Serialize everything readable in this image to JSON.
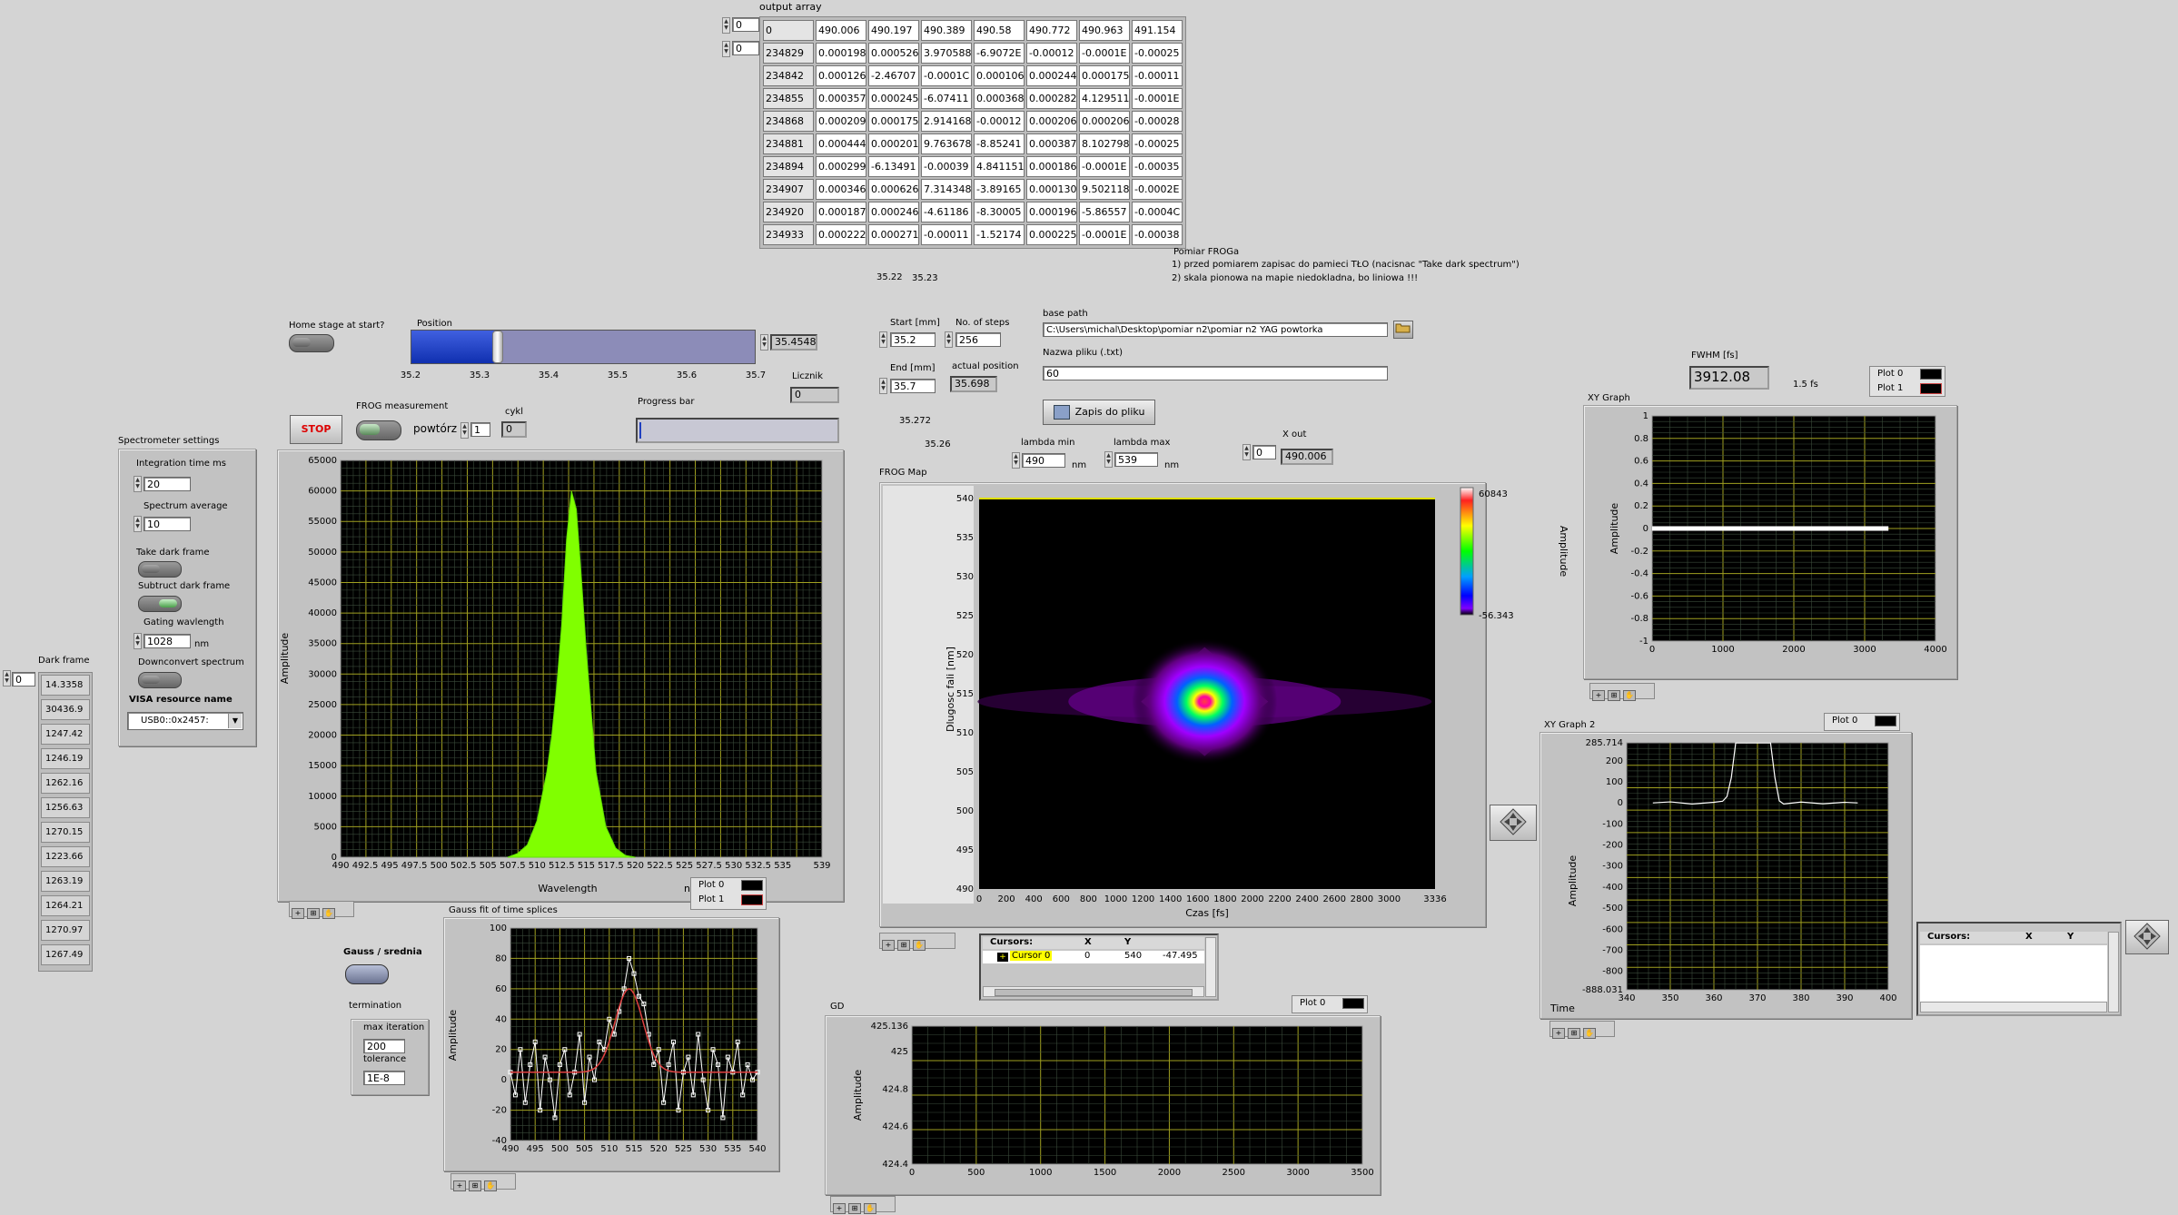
{
  "output_array": {
    "label": "output array",
    "index0": "0",
    "index1": "0",
    "rows": [
      [
        "0",
        "490.006",
        "490.197",
        "490.389",
        "490.58",
        "490.772",
        "490.963",
        "491.154"
      ],
      [
        "234829",
        "0.000198",
        "0.000526",
        "3.970588",
        "-6.9072E",
        "-0.00012",
        "-0.0001E",
        "-0.00025"
      ],
      [
        "234842",
        "0.000126",
        "-2.46707",
        "-0.0001C",
        "0.000106",
        "0.000244",
        "0.000175",
        "-0.00011"
      ],
      [
        "234855",
        "0.000357",
        "0.000245",
        "-6.07411",
        "0.000368",
        "0.000282",
        "4.129511",
        "-0.0001E"
      ],
      [
        "234868",
        "0.000209",
        "0.000175",
        "2.914168",
        "-0.00012",
        "0.000206",
        "0.000206",
        "-0.00028"
      ],
      [
        "234881",
        "0.000444",
        "0.000201",
        "9.763678",
        "-8.85241",
        "0.000387",
        "8.102798",
        "-0.00025"
      ],
      [
        "234894",
        "0.000299",
        "-6.13491",
        "-0.00039",
        "4.841151",
        "0.000186",
        "-0.0001E",
        "-0.00035"
      ],
      [
        "234907",
        "0.000346",
        "0.000626",
        "7.314348",
        "-3.89165",
        "0.000130",
        "9.502118",
        "-0.0002E"
      ],
      [
        "234920",
        "0.000187",
        "0.000246",
        "-4.61186",
        "-8.30005",
        "0.000196",
        "-5.86557",
        "-0.0004C"
      ],
      [
        "234933",
        "0.000222",
        "0.000271",
        "-0.00011",
        "-1.52174",
        "0.000225",
        "-0.0001E",
        "-0.00038"
      ]
    ]
  },
  "notes": {
    "title": "Pomiar FROGa",
    "line1": "1) przed pomiarem zapisac do pamieci TŁO (nacisnac \"Take dark spectrum\")",
    "line2": "2) skala pionowa na mapie niedokladna, bo liniowa !!!"
  },
  "floating": {
    "v1": "35.22",
    "v2": "35.23",
    "v3": "35.272",
    "v4": "35.26"
  },
  "home_stage": {
    "label": "Home stage at start?"
  },
  "position": {
    "label": "Position",
    "value": "35.4548",
    "ticks": [
      "35.2",
      "35.3",
      "35.4",
      "35.5",
      "35.6",
      "35.7"
    ],
    "fraction": 0.25
  },
  "licznik": {
    "label": "Licznik",
    "value": "0"
  },
  "progress": {
    "label": "Progress bar",
    "fraction": 0
  },
  "stop": {
    "label": "STOP"
  },
  "frog_measurement": {
    "label": "FROG measurement",
    "repeat_label": "powtórz",
    "repeat_value": "1",
    "cycle_label": "cykl",
    "cycle_value": "0"
  },
  "scan": {
    "start_label": "Start [mm]",
    "start_value": "35.2",
    "steps_label": "No. of steps",
    "steps_value": "256",
    "end_label": "End [mm]",
    "end_value": "35.7",
    "actual_label": "actual position",
    "actual_value": "35.698"
  },
  "file": {
    "base_path_label": "base path",
    "base_path_value": "C:\\Users\\michal\\Desktop\\pomiar n2\\pomiar n2 YAG powtorka",
    "name_label": "Nazwa pliku (.txt)",
    "name_value": "60",
    "save_label": "Zapis do pliku"
  },
  "lambda": {
    "min_label": "lambda min",
    "min_value": "490",
    "min_unit": "nm",
    "max_label": "lambda max",
    "max_value": "539",
    "max_unit": "nm"
  },
  "xout": {
    "label": "X out",
    "index": "0",
    "value": "490.006"
  },
  "fwhm": {
    "label": "FWHM [fs]",
    "value": "3912.08",
    "extra": "1.5 fs"
  },
  "spectrometer": {
    "title": "Spectrometer settings",
    "integration_label": "Integration time ms",
    "integration_value": "20",
    "average_label": "Spectrum average",
    "average_value": "10",
    "take_dark_label": "Take dark frame",
    "subtract_dark_label": "Subtruct dark frame",
    "gating_label": "Gating wavlength",
    "gating_value": "1028",
    "gating_unit": "nm",
    "downconvert_label": "Downconvert spectrum",
    "visa_label": "VISA resource name",
    "visa_value": "USB0::0x2457:"
  },
  "dark_frame": {
    "label": "Dark frame",
    "index": "0",
    "values": [
      "14.3358",
      "30436.9",
      "1247.42",
      "1246.19",
      "1262.16",
      "1256.63",
      "1270.15",
      "1223.66",
      "1263.19",
      "1264.21",
      "1270.97",
      "1267.49"
    ]
  },
  "gauss": {
    "toggle_label": "Gauss / srednia",
    "termination_label": "termination",
    "max_iter_label": "max iteration",
    "max_iter_value": "200",
    "tolerance_label": "tolerance",
    "tolerance_value": "1E-8"
  },
  "frog_map": {
    "title": "FROG Map",
    "xlabel": "Czas [fs]",
    "ylabel": "Dlugosc fali [nm]",
    "xticks": [
      "0",
      "200",
      "400",
      "600",
      "800",
      "1000",
      "1200",
      "1400",
      "1600",
      "1800",
      "2000",
      "2200",
      "2400",
      "2600",
      "2800",
      "3000",
      "3336"
    ],
    "yticks": [
      "540",
      "535",
      "530",
      "525",
      "520",
      "515",
      "510",
      "505",
      "500",
      "495",
      "490"
    ],
    "colorbar_max": "60843",
    "colorbar_min": "-56.343",
    "colorbar_label": "Amplitude"
  },
  "cursors": {
    "title": "Cursors:",
    "col_x": "X",
    "col_y": "Y",
    "name": "Cursor 0",
    "x": "0",
    "y": "540",
    "val": "-47.495"
  },
  "cursors2": {
    "title": "Cursors:",
    "col_x": "X",
    "col_y": "Y"
  },
  "legends": {
    "plot0": "Plot 0",
    "plot1": "Plot 1"
  },
  "graph_xy": {
    "title": "XY Graph",
    "ylabel": "Amplitude"
  },
  "graph_xy2": {
    "title": "XY Graph 2",
    "ylabel": "Amplitude",
    "xlabel": "Time"
  },
  "graph_spectrum": {
    "ylabel": "Amplitude",
    "xlabel": "Wavelength",
    "unit_partial": "n"
  },
  "graph_gauss": {
    "title": "Gauss fit of time splices",
    "ylabel": "Amplitude"
  },
  "graph_gd": {
    "title": "GD",
    "ylabel": "Amplitude"
  },
  "chart_data": [
    {
      "type": "area",
      "name": "spectrum",
      "xlim": [
        490,
        539
      ],
      "ylim": [
        0,
        65000
      ],
      "xticks": [
        490,
        492.5,
        495,
        497.5,
        500,
        502.5,
        505,
        507.5,
        510,
        512.5,
        515,
        517.5,
        520,
        522.5,
        525,
        527.5,
        530,
        532.5,
        535,
        539
      ],
      "yticks": [
        0,
        5000,
        10000,
        15000,
        20000,
        25000,
        30000,
        35000,
        40000,
        45000,
        50000,
        55000,
        60000,
        65000
      ],
      "x": [
        507,
        508,
        509,
        510,
        511,
        511.5,
        512,
        512.5,
        513,
        513.5,
        514,
        514.5,
        515,
        515.5,
        516,
        517,
        518,
        519,
        520
      ],
      "y": [
        0,
        600,
        2000,
        6000,
        14000,
        20000,
        28000,
        38000,
        52000,
        60000,
        57000,
        46000,
        34000,
        24000,
        14000,
        5000,
        1500,
        300,
        0
      ],
      "color": "#80ff00"
    },
    {
      "type": "line",
      "name": "xy_graph",
      "xlim": [
        0,
        4000
      ],
      "ylim": [
        -1,
        1
      ],
      "xticks": [
        0,
        1000,
        2000,
        3000,
        4000
      ],
      "yticks": [
        1,
        0.8,
        0.6,
        0.4,
        0.2,
        0,
        -0.2,
        -0.4,
        -0.6,
        -0.8,
        -1
      ],
      "x": [
        0,
        3336
      ],
      "y": [
        0,
        0
      ],
      "color": "#ffffff"
    },
    {
      "type": "line",
      "name": "xy_graph_2",
      "xlim": [
        340,
        400
      ],
      "ylim": [
        -888.031,
        285.714
      ],
      "xticks": [
        340,
        350,
        360,
        370,
        380,
        390,
        400
      ],
      "yticks": [
        285.714,
        200,
        100,
        0,
        -100,
        -200,
        -300,
        -400,
        -500,
        -600,
        -700,
        -800,
        -888.031
      ],
      "x": [
        346,
        350,
        355,
        360,
        362,
        363,
        364,
        365,
        366,
        368,
        370,
        372,
        373,
        374,
        375,
        376,
        380,
        385,
        390,
        393
      ],
      "y": [
        0,
        5,
        -5,
        3,
        8,
        30,
        120,
        285,
        285,
        285,
        285,
        285,
        285,
        120,
        10,
        -5,
        4,
        -4,
        3,
        0
      ],
      "color": "#ffffff"
    },
    {
      "type": "scatter",
      "name": "gauss_fit",
      "xlim": [
        490,
        540
      ],
      "ylim": [
        -40,
        100
      ],
      "xticks": [
        490,
        495,
        500,
        505,
        510,
        515,
        520,
        525,
        530,
        535,
        540
      ],
      "yticks": [
        100,
        80,
        60,
        40,
        20,
        0,
        -20,
        -40
      ],
      "x": [
        490,
        491,
        492,
        493,
        494,
        495,
        496,
        497,
        498,
        499,
        500,
        501,
        502,
        503,
        504,
        505,
        506,
        507,
        508,
        509,
        510,
        511,
        512,
        513,
        514,
        515,
        516,
        517,
        518,
        519,
        520,
        521,
        522,
        523,
        524,
        525,
        526,
        527,
        528,
        529,
        530,
        531,
        532,
        533,
        534,
        535,
        536,
        537,
        538,
        539,
        540
      ],
      "y": [
        5,
        -10,
        20,
        -15,
        10,
        25,
        -20,
        15,
        0,
        -25,
        10,
        20,
        -10,
        5,
        30,
        -15,
        15,
        0,
        25,
        20,
        40,
        30,
        45,
        60,
        80,
        70,
        55,
        50,
        30,
        10,
        20,
        -15,
        10,
        25,
        -20,
        5,
        15,
        -10,
        30,
        0,
        -20,
        20,
        10,
        -25,
        15,
        5,
        25,
        -10,
        10,
        0,
        5
      ],
      "color": "#ffffff"
    },
    {
      "type": "line",
      "name": "gd",
      "xlim": [
        0,
        3500
      ],
      "ylim": [
        424.4,
        425.136
      ],
      "xticks": [
        0,
        500,
        1000,
        1500,
        2000,
        2500,
        3000,
        3500
      ],
      "yticks": [
        425.136,
        425,
        424.8,
        424.6,
        424.4
      ],
      "x": [],
      "y": []
    },
    {
      "type": "heatmap",
      "name": "frog_map",
      "xlim": [
        0,
        3336
      ],
      "ylim": [
        490,
        540
      ],
      "color_range": [
        -56.343,
        60843
      ],
      "peak": {
        "x": 1650,
        "y": 514,
        "value": 60843
      }
    }
  ]
}
